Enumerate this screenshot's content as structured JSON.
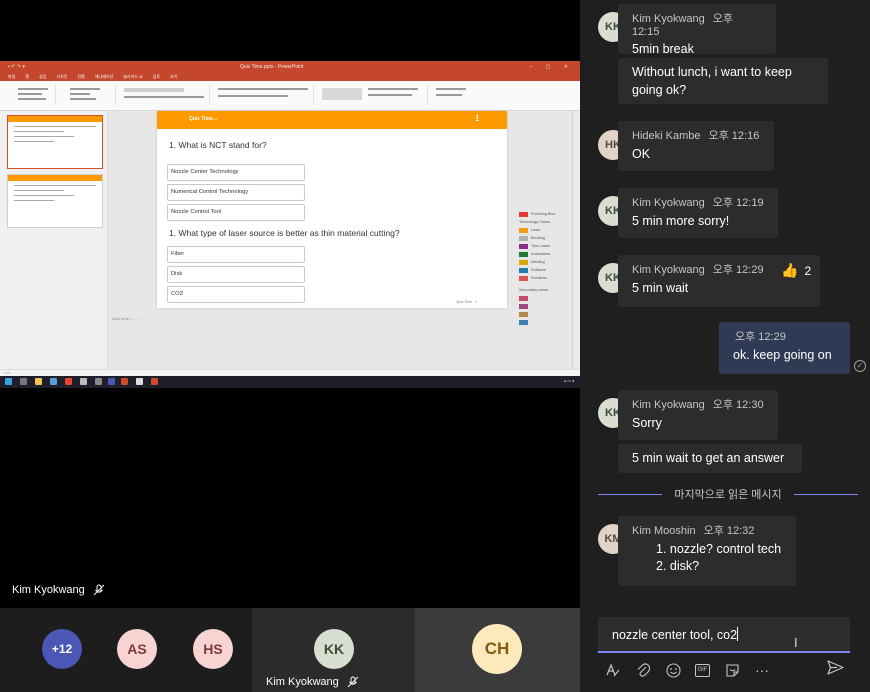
{
  "stage": {
    "speaker_name": "Kim Kyokwang",
    "shared_screen": {
      "window_title": "Quiz Time.pptx - PowerPoint",
      "tabs": [
        "파일",
        "홈",
        "삽입",
        "디자인",
        "전환",
        "애니메이션",
        "슬라이드 쇼",
        "검토",
        "보기"
      ],
      "slide": {
        "header": "Quiz Time...",
        "question1": "1. What is NCT stand for?",
        "options1": [
          "Nozzle Center Technology",
          "Numerical Control Technology",
          "Nozzle Control Tool"
        ],
        "question2": "1. What type of laser source is  better as thin material cutting?",
        "options2": [
          "Fiber",
          "Disk",
          "CO2"
        ],
        "footer": "Quiz Time · 1"
      },
      "notes": "Quiz time..........",
      "legend_title1": "Technology Colors",
      "legend_items": [
        {
          "label": "Punching Blue",
          "color": "#e53935"
        },
        {
          "label": "Laser",
          "color": "#f39c12"
        },
        {
          "label": "Bending",
          "color": "#b0b0b0"
        },
        {
          "label": "Tube Laser",
          "color": "#8e2b8e"
        },
        {
          "label": "Automation",
          "color": "#1f7a3a"
        },
        {
          "label": "Welding",
          "color": "#e0a400"
        },
        {
          "label": "Software",
          "color": "#1a7fa8"
        },
        {
          "label": "Solutions",
          "color": "#d9534f"
        }
      ],
      "legend_title2": "Secondary colors",
      "secondary_colors": [
        "#c64b6a",
        "#a0497e",
        "#b4884d",
        "#3d7fb3"
      ]
    }
  },
  "strip": {
    "more_count": "+12",
    "participants": [
      {
        "initials": "AS"
      },
      {
        "initials": "HS"
      },
      {
        "initials": "KK",
        "name": "Kim Kyokwang"
      },
      {
        "initials": "CH"
      }
    ]
  },
  "chat": {
    "messages": [
      {
        "author": "Kim Kyokwang",
        "initials": "KK",
        "time": "오후 12:15",
        "lines": [
          "5min break",
          "Without lunch, i want to keep going ok?"
        ]
      },
      {
        "author": "Hideki Kambe",
        "initials": "HK",
        "time": "오후 12:16",
        "lines": [
          "OK"
        ]
      },
      {
        "author": "Kim Kyokwang",
        "initials": "KK",
        "time": "오후 12:19",
        "lines": [
          "5 min more sorry!"
        ]
      },
      {
        "author": "Kim Kyokwang",
        "initials": "KK",
        "time": "오후 12:29",
        "lines": [
          "5 min wait"
        ],
        "reaction_count": "2"
      },
      {
        "author": "",
        "time": "오후 12:29",
        "lines": [
          "ok. keep going on"
        ]
      },
      {
        "author": "Kim Kyokwang",
        "initials": "KK",
        "time": "오후 12:30",
        "lines": [
          "Sorry",
          "5 min wait to get an answer"
        ]
      },
      {
        "author": "Kim Mooshin",
        "initials": "KM",
        "time": "오후 12:32",
        "lines": [
          "1. nozzle? control tech",
          "2. disk?"
        ]
      }
    ],
    "last_read_divider": "마지막으로 읽은 메시지",
    "compose_text": "nozzle center tool, co2"
  }
}
